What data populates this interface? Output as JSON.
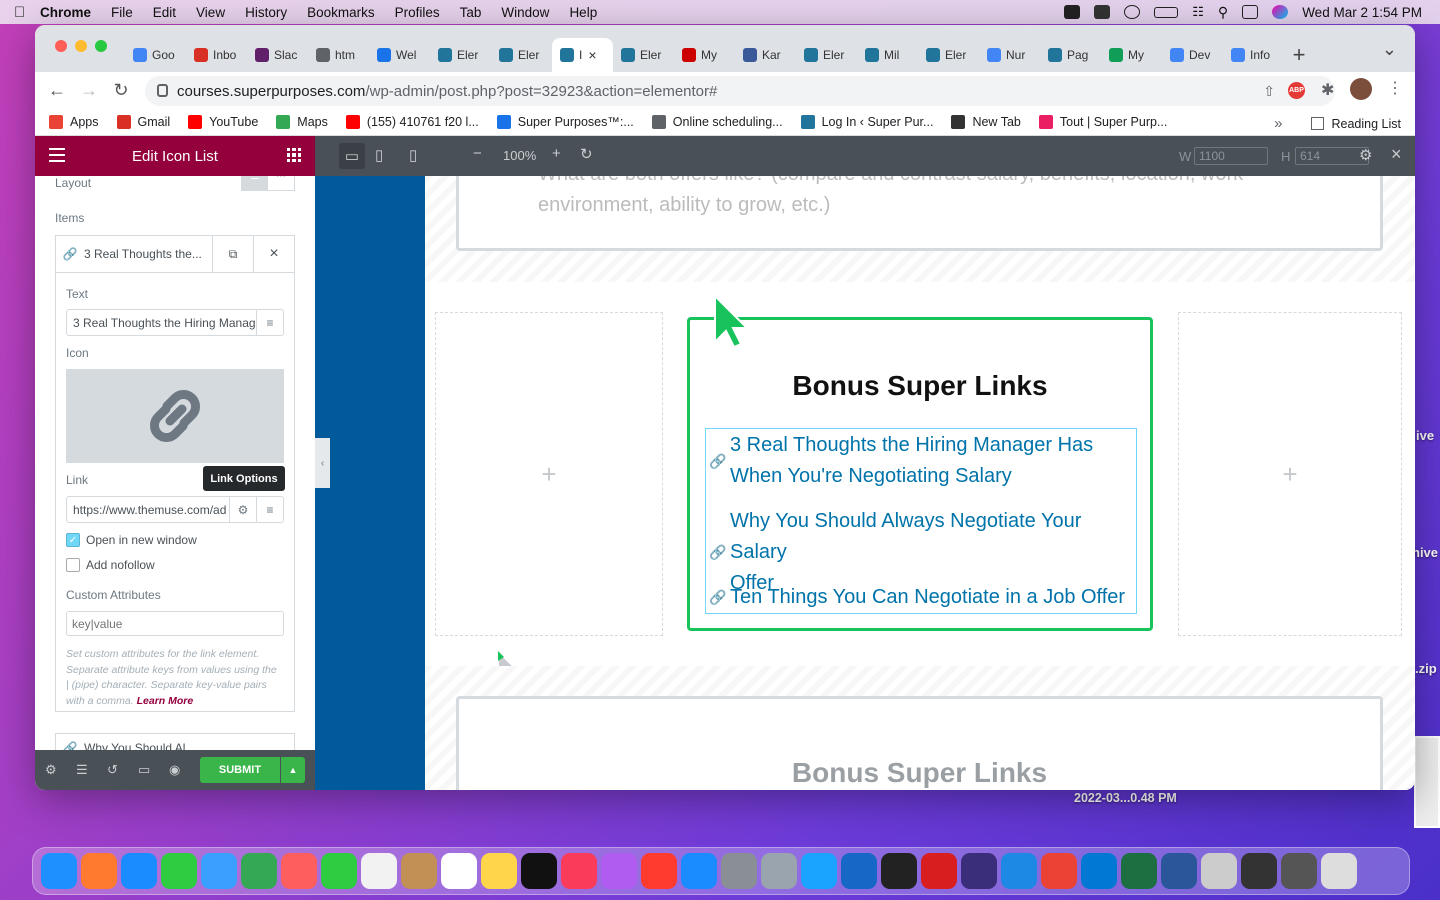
{
  "menubar": {
    "app": "Chrome",
    "items": [
      "File",
      "Edit",
      "View",
      "History",
      "Bookmarks",
      "Profiles",
      "Tab",
      "Window",
      "Help"
    ],
    "clock": "Wed Mar 2  1:54 PM"
  },
  "desktop": {
    "labels": [
      "ive",
      "hive",
      ".zip"
    ],
    "screenshot_label": "2022-03...0.48 PM"
  },
  "tabs": [
    {
      "label": "Goo",
      "icon": "google-icon",
      "color": "#4285f4"
    },
    {
      "label": "Inbo",
      "icon": "gmail-icon",
      "color": "#d93025"
    },
    {
      "label": "Slac",
      "icon": "slack-icon",
      "color": "#611f69"
    },
    {
      "label": "htm",
      "icon": "globe-icon",
      "color": "#5f6368"
    },
    {
      "label": "Wel",
      "icon": "map-pin-icon",
      "color": "#1a73e8"
    },
    {
      "label": "Eler",
      "icon": "wordpress-icon",
      "color": "#21759b"
    },
    {
      "label": "Eler",
      "icon": "wordpress-icon",
      "color": "#21759b"
    },
    {
      "label": "I",
      "icon": "wordpress-icon",
      "color": "#21759b",
      "active": true
    },
    {
      "label": "Eler",
      "icon": "wordpress-icon",
      "color": "#21759b"
    },
    {
      "label": "My",
      "icon": "calendar-icon",
      "color": "#cc0000"
    },
    {
      "label": "Kar",
      "icon": "k-icon",
      "color": "#3b5998"
    },
    {
      "label": "Eler",
      "icon": "wordpress-icon",
      "color": "#21759b"
    },
    {
      "label": "Mil",
      "icon": "wordpress-icon",
      "color": "#21759b"
    },
    {
      "label": "Eler",
      "icon": "wordpress-icon",
      "color": "#21759b"
    },
    {
      "label": "Nur",
      "icon": "docs-icon",
      "color": "#4285f4"
    },
    {
      "label": "Pag",
      "icon": "wordpress-icon",
      "color": "#21759b"
    },
    {
      "label": "My",
      "icon": "drive-icon",
      "color": "#0f9d58"
    },
    {
      "label": "Dev",
      "icon": "docs-icon",
      "color": "#4285f4"
    },
    {
      "label": "Info",
      "icon": "docs-icon",
      "color": "#4285f4"
    }
  ],
  "url": {
    "host": "courses.superpurposes.com",
    "path": "/wp-admin/post.php?post=32923&action=elementor#"
  },
  "bookmarks": [
    {
      "label": "Apps",
      "color": "#ea4335"
    },
    {
      "label": "Gmail",
      "color": "#d93025"
    },
    {
      "label": "YouTube",
      "color": "#ff0000"
    },
    {
      "label": "Maps",
      "color": "#34a853"
    },
    {
      "label": "(155) 410761 f20 l...",
      "color": "#ff0000"
    },
    {
      "label": "Super Purposes™:...",
      "color": "#1a73e8"
    },
    {
      "label": "Online scheduling...",
      "color": "#5f6368"
    },
    {
      "label": "Log In ‹ Super Pur...",
      "color": "#21759b"
    },
    {
      "label": "New Tab",
      "color": "#333"
    },
    {
      "label": "Tout | Super Purp...",
      "color": "#e91e63"
    }
  ],
  "reading_list": "Reading List",
  "panel": {
    "title": "Edit Icon List",
    "layout_label": "Layout",
    "items_label": "Items",
    "item1_title": "3 Real Thoughts the...",
    "text_label": "Text",
    "text_value": "3 Real Thoughts the Hiring Manag",
    "icon_label": "Icon",
    "link_label": "Link",
    "tooltip": "Link Options",
    "link_value": "https://www.themuse.com/ad",
    "open_new_window": "Open in new window",
    "add_nofollow": "Add nofollow",
    "custom_attr_label": "Custom Attributes",
    "custom_attr_placeholder": "key|value",
    "help_text": "Set custom attributes for the link element. Separate attribute keys from values using the | (pipe) character. Separate key-value pairs with a comma.",
    "learn_more": "Learn More",
    "item2_title": "Why You Should Al...",
    "submit": "SUBMIT"
  },
  "responsive": {
    "zoom": "100%",
    "w_label": "W",
    "w_placeholder": "1100",
    "h_label": "H",
    "h_placeholder": "614"
  },
  "canvas": {
    "top_text_1": "What are both offers like? (compare and contrast salary, benefits, location, work",
    "top_text_2": "environment, ability to grow, etc.)",
    "heading": "Bonus Super Links",
    "links": [
      {
        "line1": "3 Real Thoughts the Hiring Manager Has",
        "line2": "When You're Negotiating Salary"
      },
      {
        "line1": "Why You Should Always Negotiate Your Salary",
        "line2": "Offer"
      },
      {
        "line1": "Ten Things You Can Negotiate in a Job Offer",
        "line2": ""
      }
    ],
    "heading2": "Bonus Super Links"
  },
  "colors": {
    "elementor": "#93003c",
    "link": "#0073aa",
    "selected_border": "#19c35c",
    "submit": "#39b54a"
  }
}
